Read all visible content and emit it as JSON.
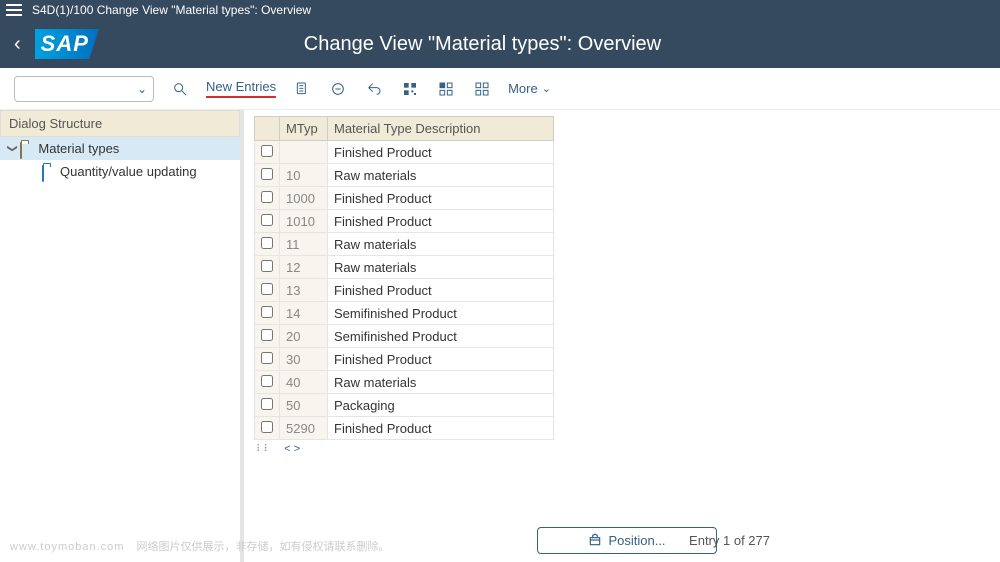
{
  "top_bar": {
    "title": "S4D(1)/100 Change View \"Material types\": Overview"
  },
  "header": {
    "title": "Change View \"Material types\": Overview",
    "logo": "SAP"
  },
  "toolbar": {
    "new_entries": "New Entries",
    "more": "More"
  },
  "sidebar": {
    "header": "Dialog Structure",
    "items": [
      {
        "label": "Material types",
        "expanded": true,
        "selected": true
      },
      {
        "label": "Quantity/value updating",
        "child": true
      }
    ]
  },
  "table": {
    "columns": {
      "mtyp": "MTyp",
      "desc": "Material Type Description"
    },
    "rows": [
      {
        "mtyp": "",
        "desc": "Finished Product"
      },
      {
        "mtyp": "10",
        "desc": "Raw materials"
      },
      {
        "mtyp": "1000",
        "desc": "Finished Product"
      },
      {
        "mtyp": "1010",
        "desc": "Finished Product"
      },
      {
        "mtyp": "11",
        "desc": "Raw materials"
      },
      {
        "mtyp": "12",
        "desc": "Raw materials"
      },
      {
        "mtyp": "13",
        "desc": "Finished Product"
      },
      {
        "mtyp": "14",
        "desc": "Semifinished Product"
      },
      {
        "mtyp": "20",
        "desc": "Semifinished Product"
      },
      {
        "mtyp": "30",
        "desc": "Finished Product"
      },
      {
        "mtyp": "40",
        "desc": "Raw materials"
      },
      {
        "mtyp": "50",
        "desc": "Packaging"
      },
      {
        "mtyp": "5290",
        "desc": "Finished Product"
      }
    ]
  },
  "footer": {
    "position_label": "Position...",
    "entry_info": "Entry 1 of 277"
  },
  "watermark": {
    "domain": "www.toymoban.com",
    "note": "网络图片仅供展示，非存储，如有侵权请联系删除。"
  }
}
